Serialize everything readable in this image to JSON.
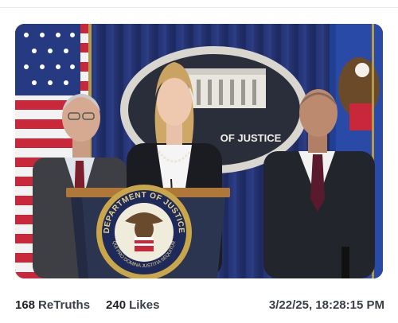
{
  "post": {
    "media": {
      "seal_text": "DEPARTMENT OF JUSTICE",
      "seal_motto": "QUI PRO DOMINA JUSTITIA SEQUITUR",
      "backdrop_text": "OF JUSTICE"
    },
    "stats": {
      "retruths_count": "168",
      "retruths_label": "ReTruths",
      "likes_count": "240",
      "likes_label": "Likes"
    },
    "timestamp": "3/22/25, 18:28:15 PM"
  },
  "colors": {
    "curtain": "#1c2b63",
    "podium": "#2c3550",
    "seal_gold": "#c9a649",
    "muted_text": "#3a3f47"
  }
}
